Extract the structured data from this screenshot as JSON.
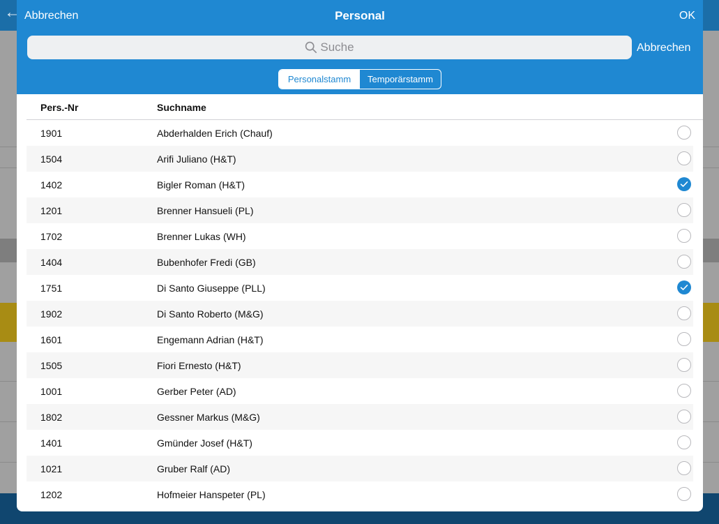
{
  "modal": {
    "title": "Personal",
    "cancel_label": "Abbrechen",
    "ok_label": "OK"
  },
  "search": {
    "placeholder": "Suche",
    "cancel_label": "Abbrechen"
  },
  "segments": [
    {
      "label": "Personalstamm",
      "selected": true
    },
    {
      "label": "Temporärstamm",
      "selected": false
    }
  ],
  "table": {
    "columns": [
      "Pers.-Nr",
      "Suchname"
    ],
    "rows": [
      {
        "nr": "1901",
        "name": "Abderhalden Erich (Chauf)",
        "checked": false
      },
      {
        "nr": "1504",
        "name": "Arifi Juliano (H&T)",
        "checked": false
      },
      {
        "nr": "1402",
        "name": "Bigler Roman (H&T)",
        "checked": true
      },
      {
        "nr": "1201",
        "name": "Brenner Hansueli (PL)",
        "checked": false
      },
      {
        "nr": "1702",
        "name": "Brenner Lukas (WH)",
        "checked": false
      },
      {
        "nr": "1404",
        "name": "Bubenhofer Fredi (GB)",
        "checked": false
      },
      {
        "nr": "1751",
        "name": "Di Santo Giuseppe (PLL)",
        "checked": true
      },
      {
        "nr": "1902",
        "name": "Di Santo Roberto (M&G)",
        "checked": false
      },
      {
        "nr": "1601",
        "name": "Engemann Adrian (H&T)",
        "checked": false
      },
      {
        "nr": "1505",
        "name": "Fiori Ernesto (H&T)",
        "checked": false
      },
      {
        "nr": "1001",
        "name": "Gerber Peter (AD)",
        "checked": false
      },
      {
        "nr": "1802",
        "name": "Gessner Markus (M&G)",
        "checked": false
      },
      {
        "nr": "1401",
        "name": "Gmünder Josef (H&T)",
        "checked": false
      },
      {
        "nr": "1021",
        "name": "Gruber Ralf (AD)",
        "checked": false
      },
      {
        "nr": "1202",
        "name": "Hofmeier Hanspeter (PL)",
        "checked": false
      }
    ]
  },
  "colors": {
    "accent": "#1f88d2",
    "row_alt": "#f6f6f6"
  }
}
